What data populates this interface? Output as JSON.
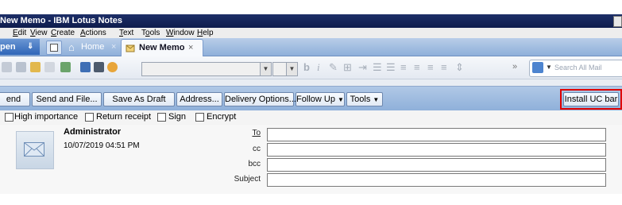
{
  "window": {
    "title": "New Memo - IBM Lotus Notes"
  },
  "menu": [
    {
      "pre": "",
      "u": "E",
      "post": "dit"
    },
    {
      "pre": "",
      "u": "V",
      "post": "iew"
    },
    {
      "pre": "",
      "u": "C",
      "post": "reate"
    },
    {
      "pre": "",
      "u": "A",
      "post": "ctions"
    },
    {
      "pre": "",
      "u": "T",
      "post": "ext"
    },
    {
      "pre": "T",
      "u": "o",
      "post": "ols"
    },
    {
      "pre": "",
      "u": "W",
      "post": "indow"
    },
    {
      "pre": "",
      "u": "H",
      "post": "elp"
    }
  ],
  "tabs": {
    "open_label": "pen",
    "home_label": "Home",
    "memo_label": "New Memo",
    "close_glyph": "×"
  },
  "search": {
    "placeholder": "Search All Mail"
  },
  "actions": {
    "send": "end",
    "send_and_file": "Send and File...",
    "save_as_draft": "Save As Draft",
    "address": "Address...",
    "delivery_options": "Delivery Options...",
    "follow_up": "Follow Up",
    "tools": "Tools",
    "install_uc_bar": "Install UC bar"
  },
  "options": {
    "high_importance": "High importance",
    "return_receipt": "Return receipt",
    "sign": "Sign",
    "encrypt": "Encrypt"
  },
  "memo": {
    "sender": "Administrator",
    "date": "10/07/2019 04:51 PM",
    "to_label": "To",
    "cc_label": "cc",
    "bcc_label": "bcc",
    "subject_label": "Subject",
    "to_value": "",
    "cc_value": "",
    "bcc_value": "",
    "subject_value": ""
  },
  "colors": {
    "highlight_box": "#e00000",
    "titlebar": "#13245a"
  }
}
